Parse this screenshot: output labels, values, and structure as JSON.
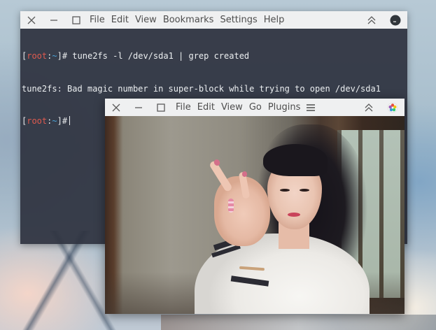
{
  "terminal": {
    "menu": [
      "File",
      "Edit",
      "View",
      "Bookmarks",
      "Settings",
      "Help"
    ],
    "lines": {
      "line1_bracket_open": "[",
      "line1_user": "root",
      "line1_colon": ":",
      "line1_dir": "~",
      "line1_bracket_close": "]# ",
      "line1_command": "tune2fs -l /dev/sda1 | grep created",
      "line2_output": "tune2fs: Bad magic number in super-block while trying to open /dev/sda1",
      "line3_bracket_open": "[",
      "line3_user": "root",
      "line3_colon": ":",
      "line3_dir": "~",
      "line3_bracket_close": "]#"
    },
    "icons": {
      "close": "close-icon",
      "minimize": "minimize-icon",
      "maximize": "maximize-icon",
      "keep_above": "keep-above-icon",
      "app": "terminal-app-icon"
    }
  },
  "viewer": {
    "menu": [
      "File",
      "Edit",
      "View",
      "Go",
      "Plugins"
    ],
    "icons": {
      "close": "close-icon",
      "minimize": "minimize-icon",
      "maximize": "maximize-icon",
      "hamburger": "hamburger-menu-icon",
      "keep_above": "keep-above-icon",
      "app": "image-viewer-app-icon"
    }
  },
  "colors": {
    "titlebar": "#eff0f1",
    "terminal_bg": "#2e333f",
    "prompt_user": "#e05a4f",
    "prompt_dir": "#4aa3d9",
    "terminal_text": "#eceff1"
  }
}
